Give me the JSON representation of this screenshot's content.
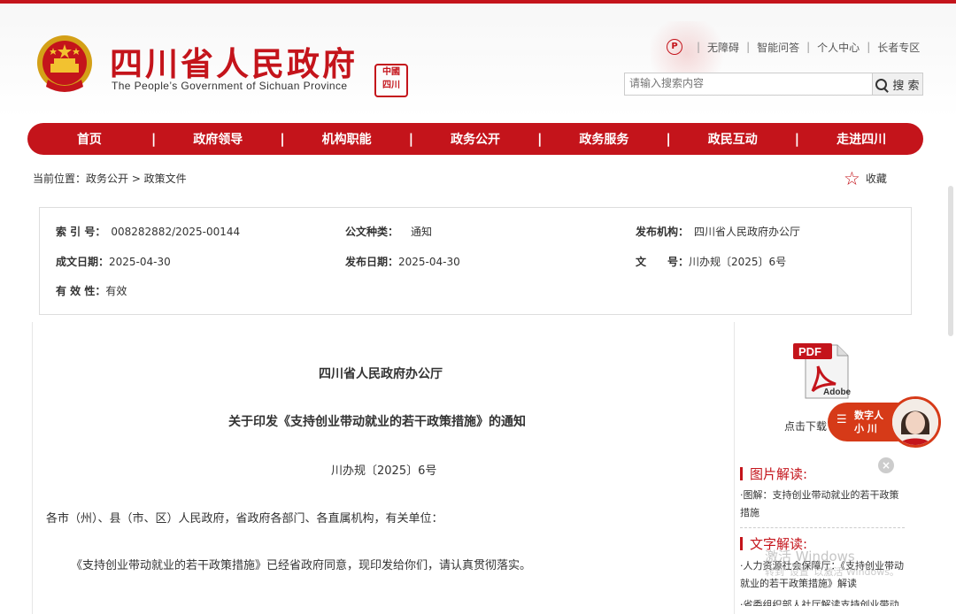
{
  "header": {
    "title": "四川省人民政府",
    "subtitle": "The People’s Government of Sichuan Province",
    "seal_text": "中國四川",
    "links": [
      "无障碍",
      "智能问答",
      "个人中心",
      "长者专区"
    ],
    "search_placeholder": "请输入搜索内容",
    "search_button": "搜 索"
  },
  "nav": {
    "items": [
      "首页",
      "政府领导",
      "机构职能",
      "政务公开",
      "政务服务",
      "政民互动",
      "走进四川"
    ],
    "separator": "|"
  },
  "breadcrumb": "当前位置：政务公开 > 政策文件",
  "favorite": "收藏",
  "info": {
    "index_label": "索 引 号：",
    "index_value": "008282882/2025-00144",
    "type_label": "公文种类：",
    "type_value": "通知",
    "issuer_label": "发布机构：",
    "issuer_value": "四川省人民政府办公厅",
    "created_label": "成文日期：",
    "created_value": "2025-04-30",
    "published_label": "发布日期：",
    "published_value": "2025-04-30",
    "docno_label": "文　　号：",
    "docno_value": "川办规〔2025〕6号",
    "validity_label": "有 效 性：",
    "validity_value": "有效"
  },
  "document": {
    "issuer": "四川省人民政府办公厅",
    "title": "关于印发《支持创业带动就业的若干政策措施》的通知",
    "number": "川办规〔2025〕6号",
    "paragraph1": "各市（州）、县（市、区）人民政府，省政府各部门、各直属机构，有关单位：",
    "paragraph2": "《支持创业带动就业的若干政策措施》已经省政府同意，现印发给你们，请认真贯彻落实。"
  },
  "sidebar": {
    "pdf_label": "PDF",
    "adobe_label": "Adobe",
    "download_text": "点击下载",
    "avatar_label_line1": "数字人",
    "avatar_label_line2": "小 川",
    "close_symbol": "×",
    "image_section": "图片解读:",
    "image_item": "·图解：支持创业带动就业的若干政策措施",
    "text_section": "文字解读:",
    "text_item": "·人力资源社会保障厅：《支持创业带动就业的若干政策措施》解读",
    "cut_item": "·省委组织部人社厅解读支持创业带动就业..."
  },
  "watermark": {
    "line1": "激活 Windows",
    "line2": "转到“设置”以激活 Windows。"
  },
  "colors": {
    "brand_red": "#c4141b",
    "avatar_orange": "#d63a18"
  }
}
